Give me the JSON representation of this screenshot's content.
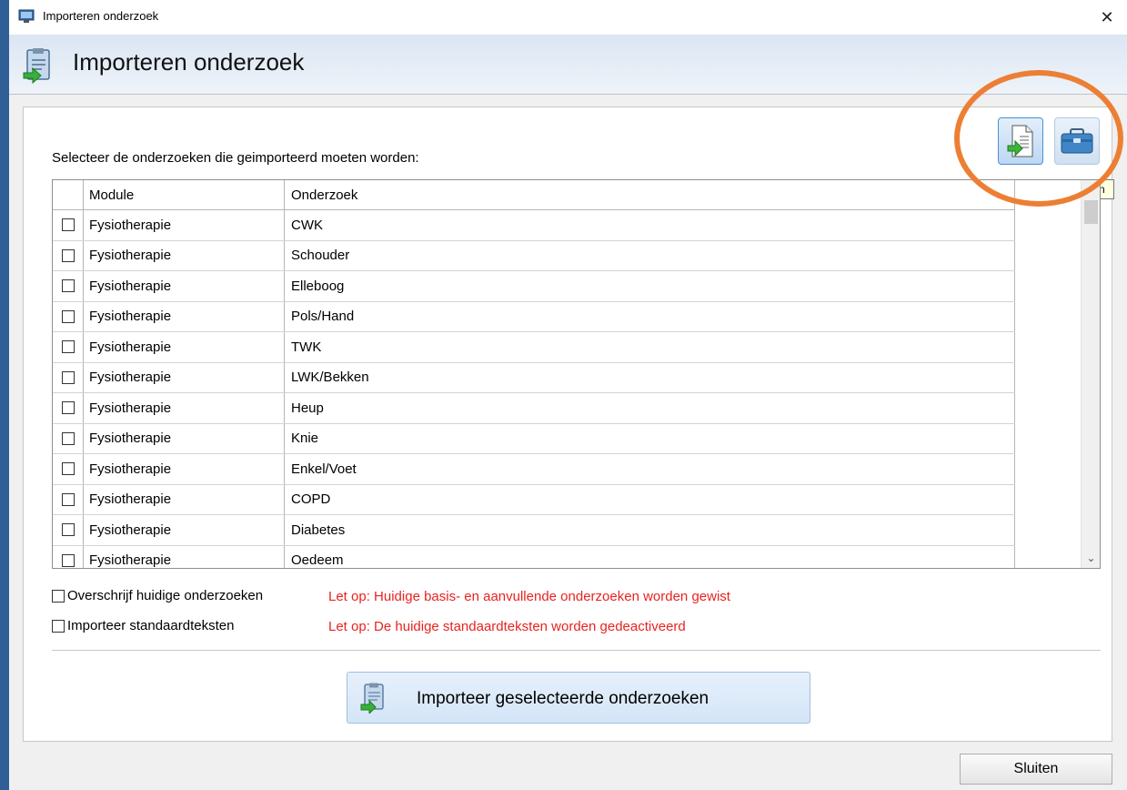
{
  "window": {
    "title": "Importeren onderzoek",
    "close_glyph": "✕"
  },
  "header": {
    "title": "Importeren onderzoek",
    "icon": "import-document-icon"
  },
  "toolbar": {
    "import_file_icon": "import-file-icon",
    "toolbox_icon": "toolbox-icon",
    "tooltip": "Importeren van"
  },
  "main": {
    "instruction": "Selecteer de onderzoeken die geimporteerd moeten worden:",
    "columns": [
      "Module",
      "Onderzoek"
    ],
    "rows": [
      {
        "module": "Fysiotherapie",
        "onderzoek": "CWK"
      },
      {
        "module": "Fysiotherapie",
        "onderzoek": "Schouder"
      },
      {
        "module": "Fysiotherapie",
        "onderzoek": "Elleboog"
      },
      {
        "module": "Fysiotherapie",
        "onderzoek": "Pols/Hand"
      },
      {
        "module": "Fysiotherapie",
        "onderzoek": "TWK"
      },
      {
        "module": "Fysiotherapie",
        "onderzoek": "LWK/Bekken"
      },
      {
        "module": "Fysiotherapie",
        "onderzoek": "Heup"
      },
      {
        "module": "Fysiotherapie",
        "onderzoek": "Knie"
      },
      {
        "module": "Fysiotherapie",
        "onderzoek": "Enkel/Voet"
      },
      {
        "module": "Fysiotherapie",
        "onderzoek": "COPD"
      },
      {
        "module": "Fysiotherapie",
        "onderzoek": "Diabetes"
      },
      {
        "module": "Fysiotherapie",
        "onderzoek": "Oedeem"
      }
    ],
    "options": {
      "overwrite_label": "Overschrijf huidige onderzoeken",
      "overwrite_warning": "Let op: Huidige basis- en aanvullende onderzoeken worden gewist",
      "standard_label": "Importeer standaardteksten",
      "standard_warning": "Let op: De huidige standaardteksten worden gedeactiveerd"
    },
    "import_button": "Importeer geselecteerde onderzoeken"
  },
  "footer": {
    "close_button": "Sluiten"
  },
  "colors": {
    "warning": "#e8231f",
    "highlight_ring": "#ec7f34",
    "desktop": "#3b6ea5"
  }
}
